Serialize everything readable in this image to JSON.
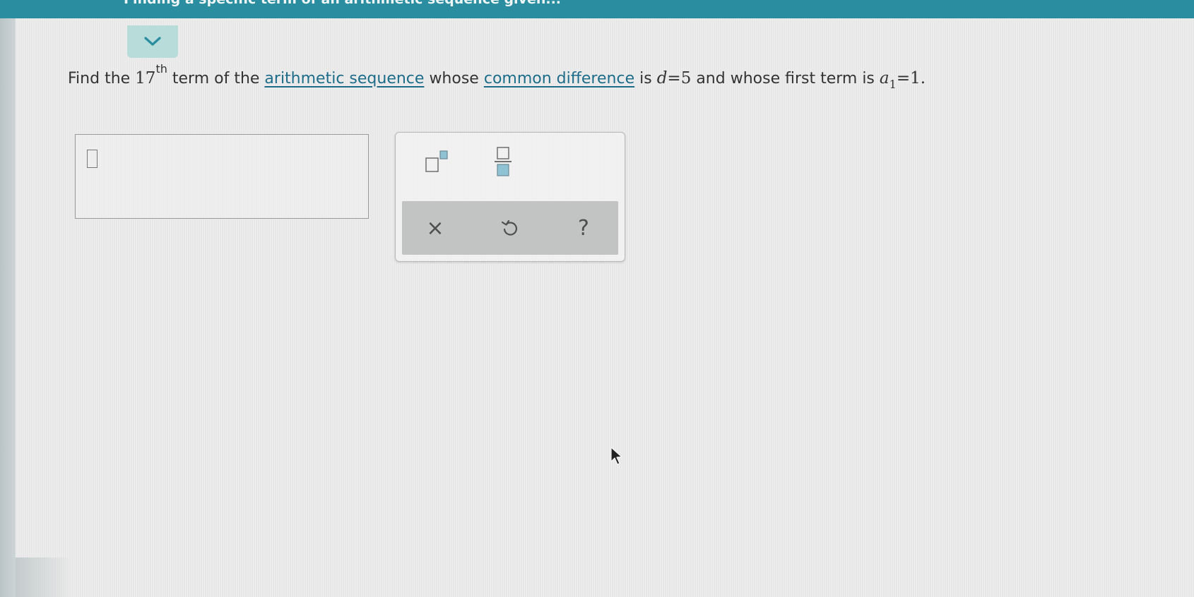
{
  "header": {
    "title": "Finding a specific term of an arithmetic sequence given..."
  },
  "collapse": {
    "icon": "chevron-down-icon"
  },
  "question": {
    "find_the": "Find the",
    "ordinal_number": "17",
    "ordinal_suffix": "th",
    "text_term_of": "term of the",
    "link_sequence": "arithmetic sequence",
    "text_whose": "whose",
    "link_difference": "common difference",
    "text_is": "is",
    "d_var": "d",
    "d_eq": "=5",
    "text_first_term": "and whose first term is",
    "a_var": "a",
    "a_sub": "1",
    "a_eq": "=1."
  },
  "answer": {
    "value": ""
  },
  "palette": {
    "buttons": [
      "superscript-button",
      "fraction-button"
    ],
    "actions": {
      "clear": "×",
      "undo_icon": "undo-icon",
      "help": "?"
    }
  },
  "colors": {
    "header": "#2a8ea0",
    "link": "#1d6d8a",
    "tab": "#b8dcd9",
    "action_bar": "#c2c4c4"
  }
}
